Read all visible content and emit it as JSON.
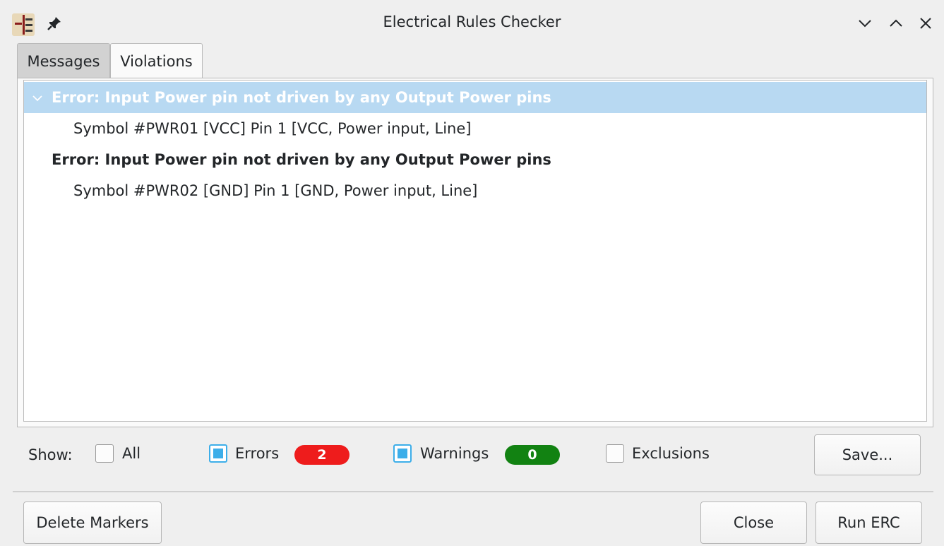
{
  "window": {
    "title": "Electrical Rules Checker",
    "icons": [
      "kicad-eeschema-icon",
      "pin-icon",
      "minimize-icon",
      "maximize-icon",
      "close-icon"
    ]
  },
  "tabs": [
    {
      "label": "Messages",
      "active": false
    },
    {
      "label": "Violations",
      "active": true
    }
  ],
  "violations": [
    {
      "text": "Error: Input Power pin not driven by any Output Power pins",
      "type": "error",
      "selected": true,
      "expanded": true
    },
    {
      "text": "Symbol #PWR01 [VCC] Pin 1 [VCC, Power input, Line]",
      "type": "detail"
    },
    {
      "text": "Error: Input Power pin not driven by any Output Power pins",
      "type": "error"
    },
    {
      "text": "Symbol #PWR02 [GND] Pin 1 [GND, Power input, Line]",
      "type": "detail"
    }
  ],
  "filters": {
    "show_label": "Show:",
    "all": {
      "label": "All",
      "checked": false
    },
    "errors": {
      "label": "Errors",
      "checked": true,
      "count": "2",
      "color": "#ee1c1c"
    },
    "warnings": {
      "label": "Warnings",
      "checked": true,
      "count": "0",
      "color": "#128212"
    },
    "exclusions": {
      "label": "Exclusions",
      "checked": false
    }
  },
  "buttons": {
    "save": "Save...",
    "delete_markers": "Delete Markers",
    "close": "Close",
    "run_erc": "Run ERC"
  },
  "colors": {
    "selection": "#b8d9f2",
    "checkbox_accent": "#3daee9"
  }
}
